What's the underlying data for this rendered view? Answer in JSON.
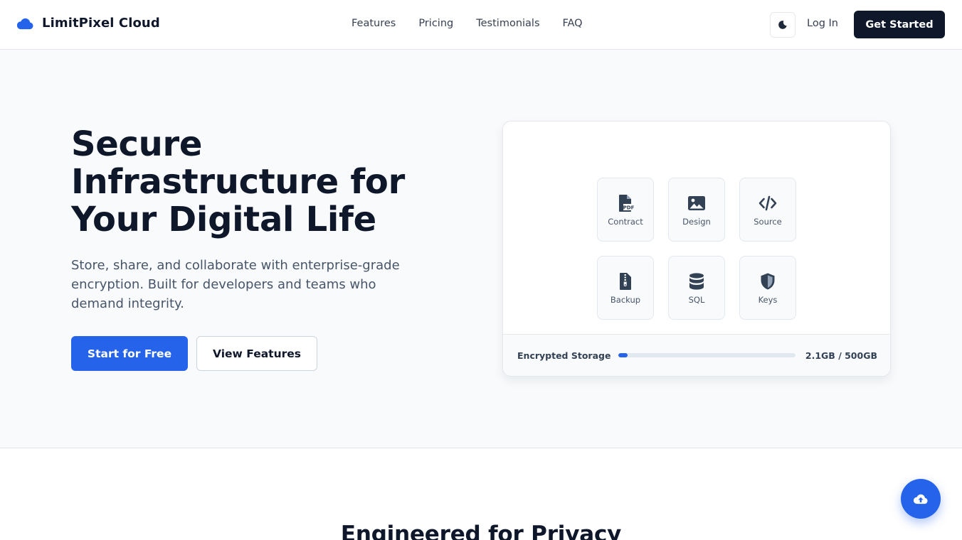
{
  "brand": {
    "name": "LimitPixel Cloud",
    "logo_icon": "cloud-icon",
    "accent": "#2563eb"
  },
  "nav": {
    "items": [
      {
        "label": "Features"
      },
      {
        "label": "Pricing"
      },
      {
        "label": "Testimonials"
      },
      {
        "label": "FAQ"
      }
    ]
  },
  "header_actions": {
    "theme_icon": "moon-icon",
    "login_label": "Log In",
    "cta_label": "Get Started"
  },
  "hero": {
    "title": "Secure Infrastructure for Your Digital Life",
    "subtitle": "Store, share, and collaborate with enterprise-grade encryption. Built for developers and teams who demand integrity.",
    "primary_cta": "Start for Free",
    "secondary_cta": "View Features"
  },
  "storage_card": {
    "files": [
      {
        "label": "Contract",
        "icon": "pdf-file-icon"
      },
      {
        "label": "Design",
        "icon": "image-icon"
      },
      {
        "label": "Source",
        "icon": "code-icon"
      },
      {
        "label": "Backup",
        "icon": "zip-file-icon"
      },
      {
        "label": "SQL",
        "icon": "database-icon"
      },
      {
        "label": "Keys",
        "icon": "shield-icon"
      }
    ],
    "storage_label": "Encrypted Storage",
    "usage_text": "2.1GB / 500GB",
    "usage_fraction": 0.0042
  },
  "next_section": {
    "title": "Engineered for Privacy"
  },
  "fab": {
    "icon": "cloud-upload-icon"
  }
}
